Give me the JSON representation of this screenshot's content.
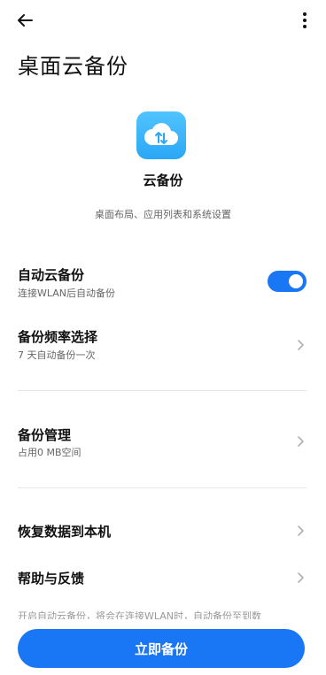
{
  "page": {
    "title": "桌面云备份"
  },
  "app": {
    "name": "云备份",
    "description": "桌面布局、应用列表和系统设置"
  },
  "settings": [
    {
      "title": "自动云备份",
      "subtitle": "连接WLAN后自动备份",
      "control": "toggle",
      "toggle_on": true
    },
    {
      "title": "备份频率选择",
      "subtitle": "7 天自动备份一次",
      "control": "chevron"
    },
    {
      "title": "备份管理",
      "subtitle": "占用0 MB空间",
      "control": "chevron"
    },
    {
      "title": "恢复数据到本机",
      "control": "chevron"
    },
    {
      "title": "帮助与反馈",
      "control": "chevron"
    }
  ],
  "footnote": "开启自动云备份，将会在连接WLAN时，自动备份至到数",
  "actions": {
    "primary_button": "立即备份"
  },
  "colors": {
    "accent": "#1976f5",
    "icon_gradient_top": "#52c4ff",
    "icon_gradient_bottom": "#2aa7f5"
  },
  "icons": {
    "back": "arrow-left",
    "more": "three-dot-vertical",
    "app": "cloud-sync",
    "chevron": "chevron-right"
  }
}
